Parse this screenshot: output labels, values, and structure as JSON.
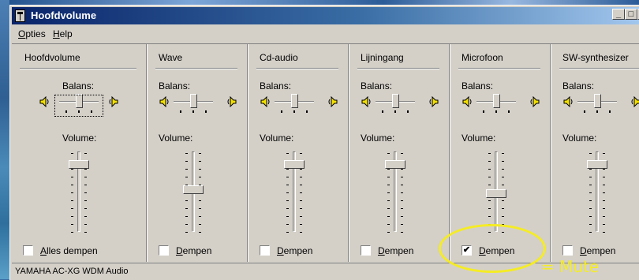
{
  "window": {
    "title": "Hoofdvolume"
  },
  "title_buttons": {
    "minimize": "_",
    "maximize": "□",
    "close": "×"
  },
  "menu": {
    "options_accel": "O",
    "options_rest": "pties",
    "help_accel": "H",
    "help_rest": "elp"
  },
  "labels": {
    "balance": "Balans:",
    "volume": "Volume:"
  },
  "channels": [
    {
      "name": "Hoofdvolume",
      "mute_prefix": "",
      "mute_accel": "A",
      "mute_rest": "lles dempen",
      "muted": false,
      "volume_level": 0.88,
      "balance": 0.0
    },
    {
      "name": "Wave",
      "mute_prefix": "",
      "mute_accel": "D",
      "mute_rest": "empen",
      "muted": false,
      "volume_level": 0.55,
      "balance": 0.0
    },
    {
      "name": "Cd-audio",
      "mute_prefix": "",
      "mute_accel": "D",
      "mute_rest": "empen",
      "muted": false,
      "volume_level": 0.88,
      "balance": 0.0
    },
    {
      "name": "Lijningang",
      "mute_prefix": "",
      "mute_accel": "D",
      "mute_rest": "empen",
      "muted": false,
      "volume_level": 0.88,
      "balance": 0.0
    },
    {
      "name": "Microfoon",
      "mute_prefix": "",
      "mute_accel": "D",
      "mute_rest": "empen",
      "muted": true,
      "volume_level": 0.5,
      "balance": 0.0
    },
    {
      "name": "SW-synthesizer",
      "mute_prefix": "",
      "mute_accel": "D",
      "mute_rest": "empen",
      "muted": false,
      "volume_level": 0.88,
      "balance": 0.0
    }
  ],
  "status": {
    "text": "YAMAHA AC-XG WDM Audio"
  },
  "annotation": {
    "text": "= Mute"
  },
  "colors": {
    "face": "#d4d0c8",
    "title_start": "#0a246a",
    "title_end": "#a6caf0",
    "annotation": "#f5ec25",
    "speaker": "#f3e000"
  }
}
